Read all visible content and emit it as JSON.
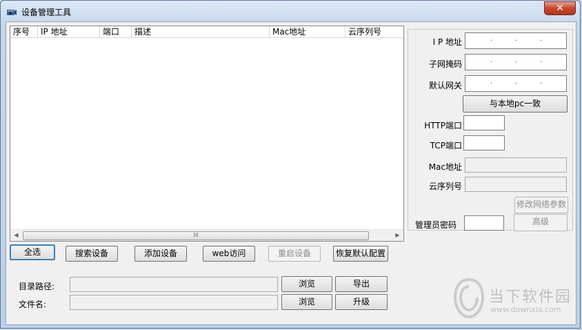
{
  "window": {
    "title": "设备管理工具",
    "close_label": "✕"
  },
  "list": {
    "columns": [
      "序号",
      "IP 地址",
      "端口",
      "描述",
      "Mac地址",
      "云序列号"
    ],
    "scroll_grip": "III"
  },
  "buttons": {
    "select_all": "全选",
    "search": "搜索设备",
    "add": "添加设备",
    "web": "web访问",
    "restart": "重启设备",
    "restore": "恢复默认配置",
    "browse1": "浏览",
    "export": "导出",
    "browse2": "浏览",
    "upgrade": "升级"
  },
  "bottom": {
    "dir_label": "目录路径:",
    "file_label": "文件名:"
  },
  "panel": {
    "ip_label": "I P 地址",
    "mask_label": "子网掩码",
    "gateway_label": "默认网关",
    "same_as_pc": "与本地pc一致",
    "http_label": "HTTP端口",
    "tcp_label": "TCP端口",
    "mac_label": "Mac地址",
    "cloud_label": "云序列号",
    "modify_net": "修改网络参数",
    "admin_pwd_label": "管理员密码",
    "advanced": "高级"
  },
  "watermark": {
    "text": "当下软件园",
    "url": "www.downxia.com"
  }
}
